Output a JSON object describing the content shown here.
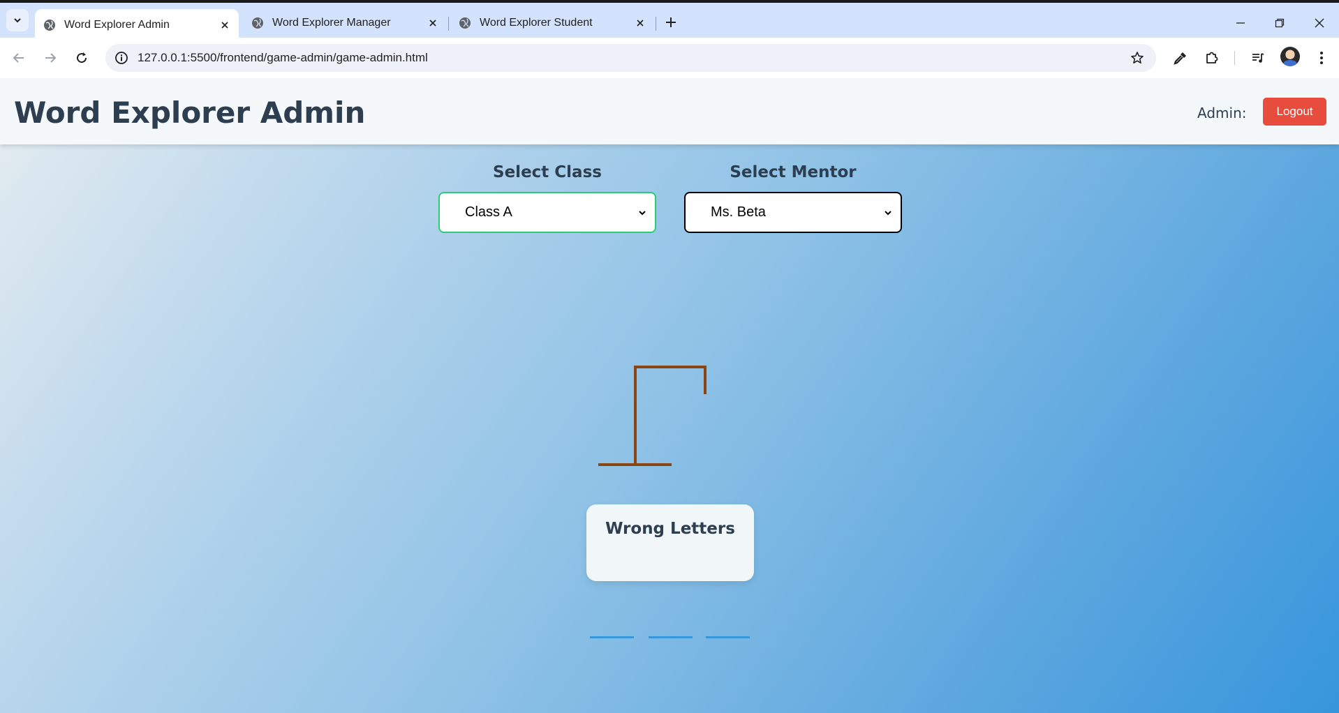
{
  "browser": {
    "tabs": [
      {
        "title": "Word Explorer Admin",
        "active": true
      },
      {
        "title": "Word Explorer Manager",
        "active": false
      },
      {
        "title": "Word Explorer Student",
        "active": false
      }
    ],
    "url": "127.0.0.1:5500/frontend/game-admin/game-admin.html"
  },
  "header": {
    "title": "Word Explorer Admin",
    "admin_label": "Admin:",
    "logout_label": "Logout"
  },
  "selectors": {
    "class_label": "Select Class",
    "class_value": "Class A",
    "mentor_label": "Select Mentor",
    "mentor_value": "Ms. Beta"
  },
  "game": {
    "wrong_letters_title": "Wrong Letters",
    "wrong_letters": "",
    "word_blank_count": 3
  },
  "colors": {
    "accent_green": "#2ecc71",
    "logout_red": "#e74c3c",
    "gallows_brown": "#8b4513",
    "blank_blue": "#3498db",
    "heading": "#2c3e50"
  }
}
